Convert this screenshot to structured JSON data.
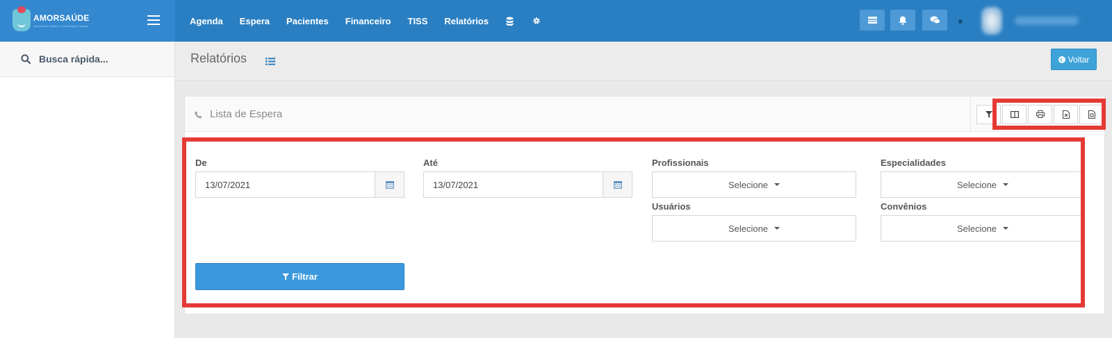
{
  "brand": {
    "name": "AMORSAÚDE",
    "tagline": "Atendimento Médico e Odontológico Integral"
  },
  "nav": {
    "items": [
      "Agenda",
      "Espera",
      "Pacientes",
      "Financeiro",
      "TISS",
      "Relatórios"
    ],
    "icons": [
      "database-icon",
      "gear-icon"
    ]
  },
  "topbar": {
    "icons": [
      "card-icon",
      "bell-icon",
      "chat-icon"
    ],
    "user_name": "User Name"
  },
  "sidebar": {
    "search_label": "Busca rápida..."
  },
  "header": {
    "title": "Relatórios",
    "separator": "/",
    "back_label": "Voltar"
  },
  "panel": {
    "title": "Lista de Espera",
    "tools": [
      "filter-icon",
      "columns-icon",
      "print-icon",
      "excel-icon",
      "pdf-icon"
    ]
  },
  "form": {
    "de_label": "De",
    "de_value": "13/07/2021",
    "ate_label": "Até",
    "ate_value": "13/07/2021",
    "profissionais_label": "Profissionais",
    "especialidades_label": "Especialidades",
    "usuarios_label": "Usuários",
    "convenios_label": "Convênios",
    "select_placeholder": "Selecione",
    "filter_label": "Filtrar"
  },
  "colors": {
    "topbar": "#2a7fc2",
    "brand_bg": "#3388cf",
    "primary_button": "#3a98dc",
    "annotation_red": "#e53935"
  }
}
